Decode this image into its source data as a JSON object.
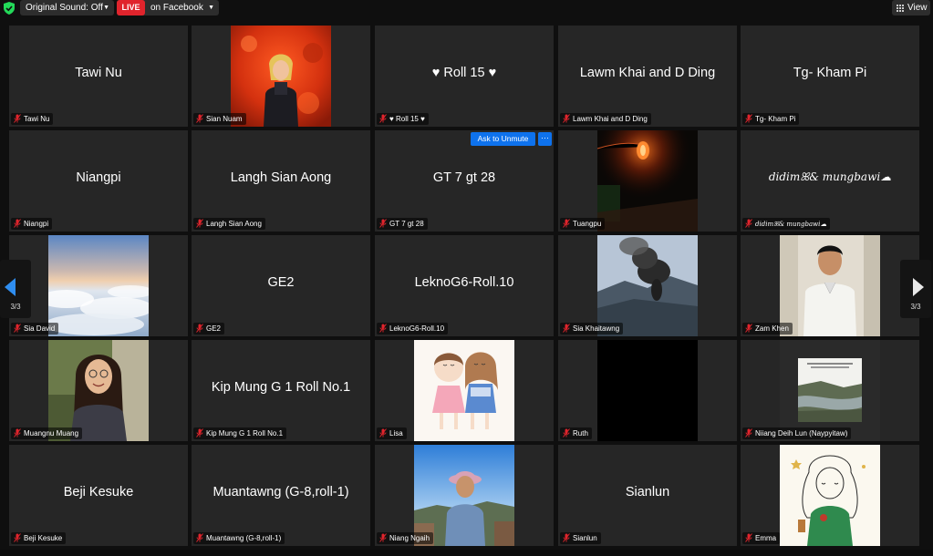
{
  "topbar": {
    "sound_label": "Original Sound: Off",
    "live_badge": "LIVE",
    "live_text": "on Facebook",
    "view_label": "View"
  },
  "tiles": [
    {
      "display": "Tawi Nu",
      "label": "Tawi Nu"
    },
    {
      "display": "",
      "label": "Sian Nuam",
      "photo": "portrait-red-foliage"
    },
    {
      "display": "♥ Roll 15 ♥",
      "label": "♥ Roll 15 ♥"
    },
    {
      "display": "Lawm Khai and D Ding",
      "label": "Lawm Khai and D Ding"
    },
    {
      "display": "Tg- Kham Pi",
      "label": "Tg- Kham Pi"
    },
    {
      "display": "Niangpi",
      "label": "Niangpi"
    },
    {
      "display": "Langh Sian Aong",
      "label": "Langh Sian Aong"
    },
    {
      "display": "GT 7  gt 28",
      "label": "GT 7  gt 28"
    },
    {
      "display": "",
      "label": "Tuangpu",
      "photo": "lantern-night"
    },
    {
      "display": "didimꕤ& mungbawi☁",
      "label": "didimꕤ& mungbawi☁",
      "cursive": true
    },
    {
      "display": "",
      "label": "Sia David",
      "photo": "clouds-sea"
    },
    {
      "display": "GE2",
      "label": "GE2"
    },
    {
      "display": "LeknoG6-Roll.10",
      "label": "LeknoG6-Roll.10"
    },
    {
      "display": "",
      "label": "Sia Khaitawng",
      "photo": "smoke-mountain"
    },
    {
      "display": "",
      "label": "Zam Khen",
      "photo": "portrait-man"
    },
    {
      "display": "",
      "label": "Muangnu Muang",
      "photo": "portrait-woman-glasses"
    },
    {
      "display": "Kip Mung G 1 Roll No.1",
      "label": "Kip Mung G 1 Roll No.1"
    },
    {
      "display": "",
      "label": "Lisa",
      "photo": "cartoon-girls"
    },
    {
      "display": "",
      "label": "Ruth",
      "photo": "black"
    },
    {
      "display": "",
      "label": "Niiang Deih Lun (Naypyitaw)",
      "photo": "landscape-text"
    },
    {
      "display": "Beji Kesuke",
      "label": "Beji Kesuke"
    },
    {
      "display": "Muantawng (G-8,roll-1)",
      "label": "Muantawng (G-8,roll-1)"
    },
    {
      "display": "",
      "label": "Niang Ngaih",
      "photo": "portrait-hat-sky"
    },
    {
      "display": "Sianlun",
      "label": "Sianlun"
    },
    {
      "display": "",
      "label": "Emma",
      "photo": "illustration-girl"
    }
  ],
  "unmute": {
    "label": "Ask to Unmute",
    "more": "···"
  },
  "pager": {
    "left_count": "3/3",
    "right_count": "3/3"
  }
}
